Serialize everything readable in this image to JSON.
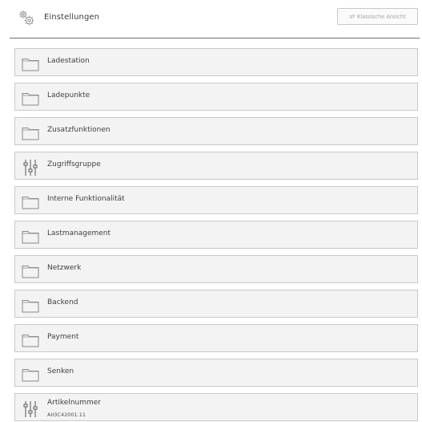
{
  "header": {
    "title": "Einstellungen",
    "icon": "gears-icon",
    "classic_view_label": "Klassische Ansicht",
    "classic_view_icon": "arrow-left-right-icon"
  },
  "items": [
    {
      "label": "Ladestation",
      "icon": "folder-icon"
    },
    {
      "label": "Ladepunkte",
      "icon": "folder-icon"
    },
    {
      "label": "Zusatzfunktionen",
      "icon": "folder-icon"
    },
    {
      "label": "Zugriffsgruppe",
      "icon": "sliders-icon"
    },
    {
      "label": "Interne Funktionalität",
      "icon": "folder-icon"
    },
    {
      "label": "Lastmanagement",
      "icon": "folder-icon"
    },
    {
      "label": "Netzwerk",
      "icon": "folder-icon"
    },
    {
      "label": "Backend",
      "icon": "folder-icon"
    },
    {
      "label": "Payment",
      "icon": "folder-icon"
    },
    {
      "label": "Senken",
      "icon": "folder-icon"
    },
    {
      "label": "Artikelnummer",
      "sublabel": "AII3C42001.11",
      "icon": "sliders-icon"
    }
  ]
}
